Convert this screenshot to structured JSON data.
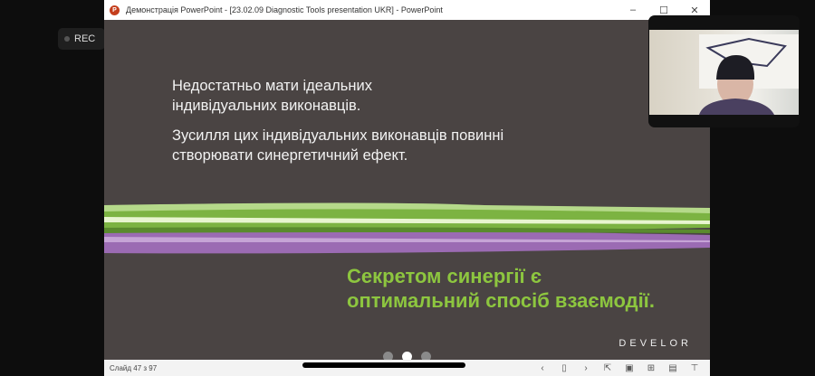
{
  "rec": {
    "label": "REC"
  },
  "window": {
    "title": "Демонстрація PowerPoint - [23.02.09 Diagnostic Tools presentation UKR] - PowerPoint",
    "app_icon": "P",
    "minimize": "–",
    "maximize": "☐",
    "close": "✕"
  },
  "slide": {
    "para1": [
      "Недостатньо мати ідеальних",
      "індивідуальних виконавців."
    ],
    "para2": [
      "Зусилля цих індивідуальних виконавців повинні",
      "створювати синергетичний ефект."
    ],
    "highlight": [
      "Секретом синергії є",
      "оптимальний спосіб взаємодії."
    ],
    "brand": "DEVELOR",
    "colors": {
      "background": "#4a4443",
      "green": "#8dc63f",
      "purple": "#9b6bb3"
    }
  },
  "status": {
    "slide_counter": "Слайд 47 з 97",
    "prev": "‹",
    "next": "›"
  }
}
